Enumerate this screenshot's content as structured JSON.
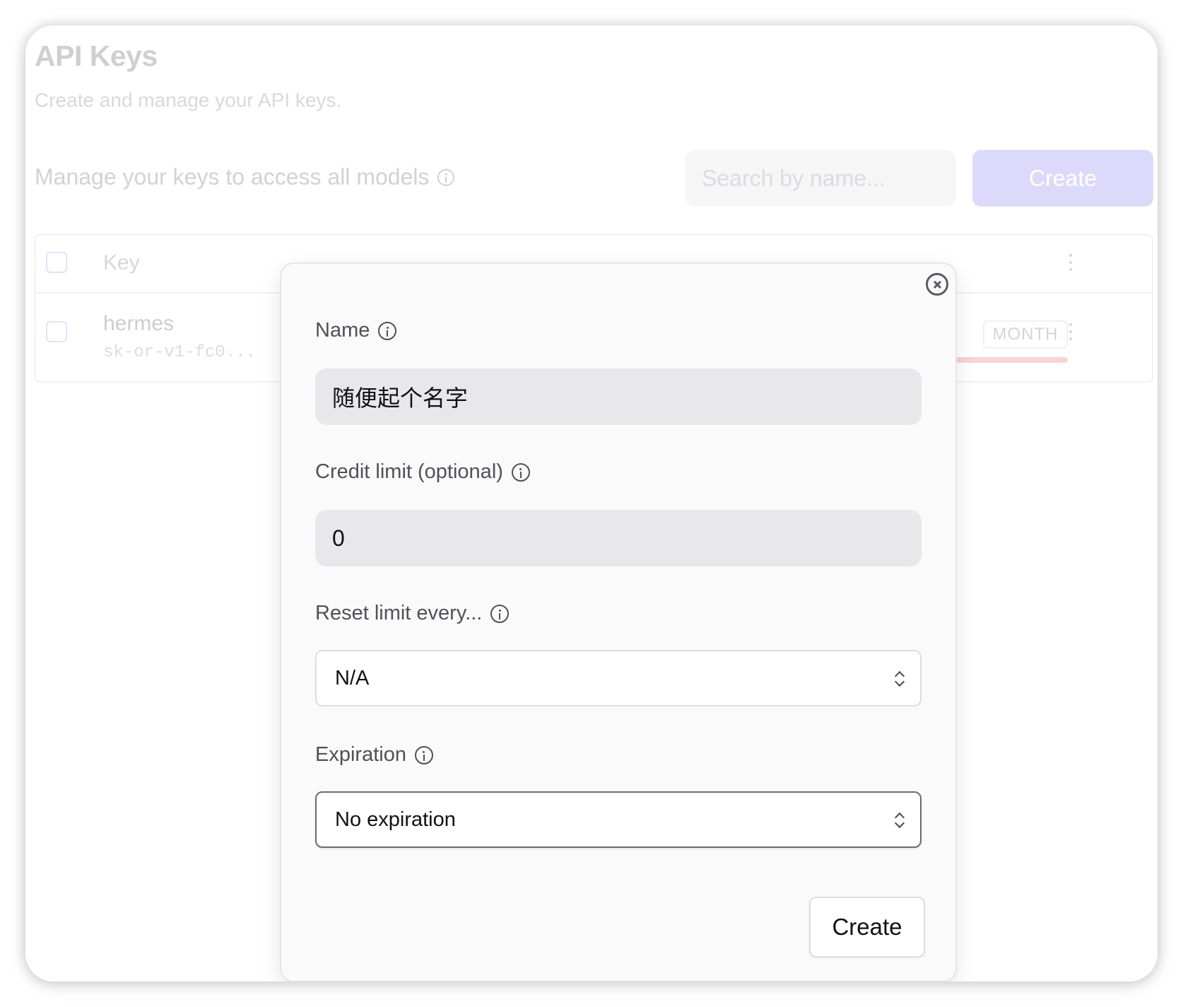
{
  "page": {
    "title": "API Keys",
    "subtitle": "Create and manage your API keys.",
    "section_label": "Manage your keys to access all models",
    "search_placeholder": "Search by name...",
    "create_label": "Create"
  },
  "table": {
    "header_key": "Key",
    "rows": [
      {
        "name": "hermes",
        "key": "sk-or-v1-fc0...",
        "reset_badge": "MONTH"
      }
    ]
  },
  "modal": {
    "name_label": "Name",
    "name_value": "随便起个名字",
    "credit_label": "Credit limit (optional)",
    "credit_value": "0",
    "reset_label": "Reset limit every...",
    "reset_value": "N/A",
    "expiration_label": "Expiration",
    "expiration_value": "No expiration",
    "create_label": "Create"
  },
  "colors": {
    "accent_faded": "#dcdafb",
    "usage_bar": "#fbd3d3",
    "modal_bg": "#fafafb",
    "input_bg": "#e8e8ea"
  },
  "icons": {
    "info": "info-icon",
    "close": "close-icon",
    "select": "chevron-up-down-icon",
    "menu": "kebab-menu-icon"
  }
}
